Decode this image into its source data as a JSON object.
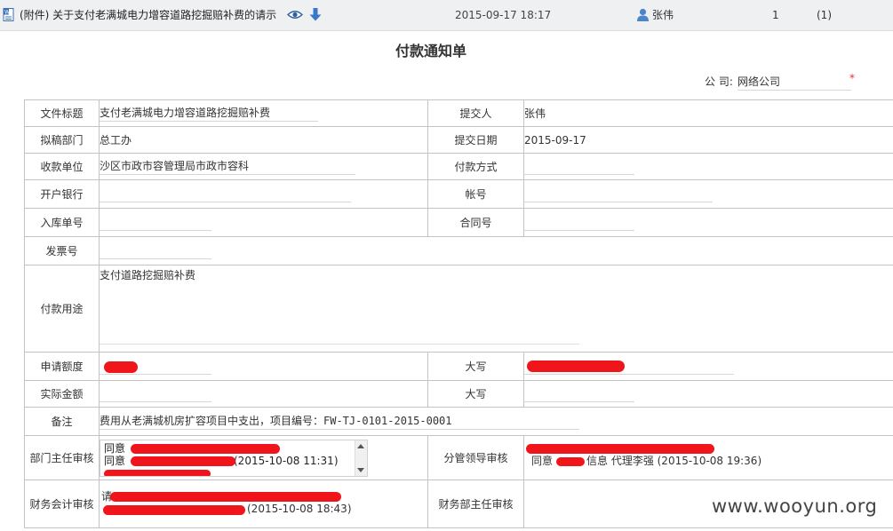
{
  "topbar": {
    "title": "(附件) 关于支付老满城电力增容道路挖掘赔补费的请示",
    "date": "2015-09-17 18:17",
    "user": "张伟",
    "count": "1",
    "paren": "(1)"
  },
  "form": {
    "title": "付款通知单",
    "company_label": "公 司:",
    "company_value": "网络公司",
    "required_mark": "*"
  },
  "rows": {
    "doc_title_label": "文件标题",
    "doc_title_value": "支付老满城电力增容道路挖掘赔补费",
    "submitter_label": "提交人",
    "submitter_value": "张伟",
    "dept_label": "拟稿部门",
    "dept_value": "总工办",
    "submit_date_label": "提交日期",
    "submit_date_value": "2015-09-17",
    "payee_label": "收款单位",
    "payee_value": "沙区市政市容管理局市政市容科",
    "pay_method_label": "付款方式",
    "bank_label": "开户银行",
    "account_label": "帐号",
    "warehouse_label": "入库单号",
    "contract_label": "合同号",
    "invoice_label": "发票号",
    "purpose_label": "付款用途",
    "purpose_value": "支付道路挖掘赔补费",
    "amount_label": "申请额度",
    "capital_label": "大写",
    "actual_label": "实际金额",
    "capital2_label": "大写",
    "remark_label": "备注",
    "remark_value": "费用从老满城机房扩容项目中支出，项目编号：FW-TJ-0101-2015-0001",
    "dept_head_label": "部门主任审核",
    "leader_label": "分管领导审核",
    "finance_label": "财务会计审核",
    "finance_head_label": "财务部主任审核"
  },
  "reviews": {
    "dept_line1_prefix": "同意",
    "dept_line2_prefix": "同意",
    "dept_line2_tail": "(2015-10-08 11:31)",
    "leader_line2_prefix": "同意",
    "leader_line2_tail": "信息 代理李强 (2015-10-08 19:36)",
    "finance_line1_prefix": "请",
    "finance_line2_tail": "(2015-10-08 18:43)"
  },
  "watermark": "www.wooyun.org",
  "colors": {
    "topbar_bg": "#eef0f2",
    "border": "#c3c3c3",
    "redaction": "#f0141b",
    "required": "#e03333"
  },
  "icons": [
    "document-icon",
    "eye-icon",
    "download-arrow-icon",
    "user-icon"
  ]
}
